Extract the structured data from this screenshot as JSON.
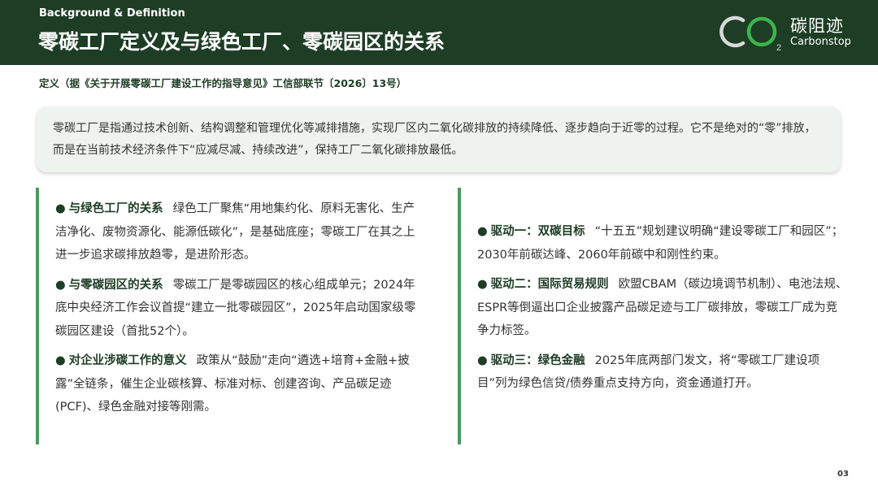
{
  "header": {
    "eyebrow": "Background & Definition",
    "title": "零碳工厂定义及与绿色工厂、零碳园区的关系",
    "logo": {
      "cn": "碳阻迹",
      "en": "Carbonstop",
      "mark_text": "CO2",
      "mark_colors": [
        "#d9d9d9",
        "#3cb44b"
      ]
    }
  },
  "subtitle": "定义（据《关于开展零碳工厂建设工作的指导意见》工信部联节〔2026〕13号）",
  "definition": "零碳工厂是指通过技术创新、结构调整和管理优化等减排措施，实现厂区内二氧化碳排放的持续降低、逐步趋向于近零的过程。它不是绝对的“零”排放，而是在当前技术经济条件下“应减尽减、持续改进”，保持工厂二氧化碳排放最低。",
  "left_items": [
    {
      "bullet": "●",
      "head": "与绿色工厂的关系",
      "text": "绿色工厂聚焦“用地集约化、原料无害化、生产洁净化、废物资源化、能源低碳化”，是基础底座；零碳工厂在其之上进一步追求碳排放趋零，是进阶形态。"
    },
    {
      "bullet": "●",
      "head": "与零碳园区的关系",
      "text": "零碳工厂是零碳园区的核心组成单元；2024年底中央经济工作会议首提“建立一批零碳园区”，2025年启动国家级零碳园区建设（首批52个）。"
    },
    {
      "bullet": "●",
      "head": "对企业涉碳工作的意义",
      "text": "政策从“鼓励”走向“遴选+培育+金融+披露”全链条，催生企业碳核算、标准对标、创建咨询、产品碳足迹(PCF)、绿色金融对接等刚需。"
    }
  ],
  "right_items": [
    {
      "bullet": "●",
      "head": "驱动一：双碳目标",
      "text": "“十五五”规划建议明确“建设零碳工厂和园区”；2030年前碳达峰、2060年前碳中和刚性约束。"
    },
    {
      "bullet": "●",
      "head": "驱动二：国际贸易规则",
      "text": "欧盟CBAM（碳边境调节机制）、电池法规、ESPR等倒逼出口企业披露产品碳足迹与工厂碳排放，零碳工厂成为竞争力标签。"
    },
    {
      "bullet": "●",
      "head": "驱动三：绿色金融",
      "text": "2025年底两部门发文，将“零碳工厂建设项目”列为绿色信贷/债券重点支持方向，资金通道打开。"
    }
  ],
  "page_number": "03",
  "colors": {
    "header_bg": "#1e3d25",
    "accent_green": "#4a9a5c",
    "box_bg": "#eef3ef"
  }
}
